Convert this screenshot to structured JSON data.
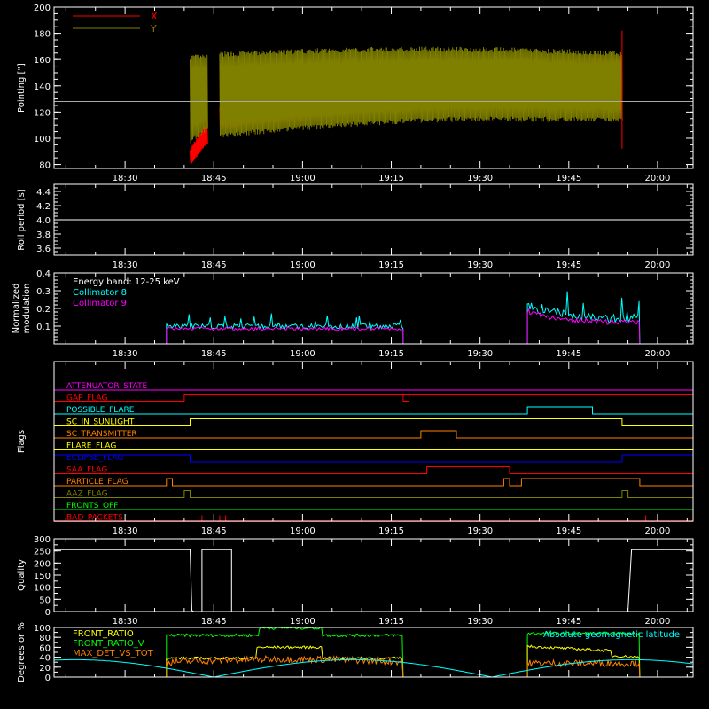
{
  "chart_data": [
    {
      "type": "line",
      "ylabel": "Pointing [\"]",
      "yticks": [
        80,
        100,
        120,
        140,
        160,
        180,
        200
      ],
      "ylim": [
        77,
        200
      ],
      "xticks": [
        "18:30",
        "18:45",
        "19:00",
        "19:15",
        "19:30",
        "19:45",
        "20:00"
      ],
      "series": [
        {
          "name": "X",
          "color": "#ff0000"
        },
        {
          "name": "Y",
          "color": "#808000"
        }
      ],
      "reference_line": 128
    },
    {
      "type": "line",
      "ylabel": "Roll period [s]",
      "yticks": [
        "3.6",
        "3.8",
        "4.0",
        "4.2",
        "4.4"
      ],
      "ylim": [
        3.5,
        4.5
      ],
      "constant_value": 4.0,
      "xticks": [
        "18:30",
        "18:45",
        "19:00",
        "19:15",
        "19:30",
        "19:45",
        "20:00"
      ]
    },
    {
      "type": "line",
      "ylabel": "Normalized modulation",
      "ylabel_lines": [
        "Normalized",
        "modulation"
      ],
      "yticks": [
        "0.1",
        "0.2",
        "0.3",
        "0.4"
      ],
      "ylim": [
        0,
        0.4
      ],
      "annotation": "Energy band: 12-25 keV",
      "series": [
        {
          "name": "Collimator 8",
          "color": "#00ffff"
        },
        {
          "name": "Collimator 9",
          "color": "#ff00ff"
        }
      ],
      "xticks": [
        "18:30",
        "18:45",
        "19:00",
        "19:15",
        "19:30",
        "19:45",
        "20:00"
      ]
    },
    {
      "type": "line",
      "ylabel": "Flags",
      "flags": [
        {
          "name": "ATTENUATOR_STATE",
          "color": "#ff00ff"
        },
        {
          "name": "GAP_FLAG",
          "color": "#ff0000"
        },
        {
          "name": "POSSIBLE_FLARE",
          "color": "#00ffff"
        },
        {
          "name": "SC_IN_SUNLIGHT",
          "color": "#ffff00"
        },
        {
          "name": "SC_TRANSMITTER",
          "color": "#ff8000"
        },
        {
          "name": "FLARE_FLAG",
          "color": "#ffff00"
        },
        {
          "name": "ECLIPSE_FLAG",
          "color": "#0000ff"
        },
        {
          "name": "SAA_FLAG",
          "color": "#ff0000"
        },
        {
          "name": "PARTICLE_FLAG",
          "color": "#ff8000"
        },
        {
          "name": "AAZ_FLAG",
          "color": "#808000"
        },
        {
          "name": "FRONTS_OFF",
          "color": "#00ff00"
        },
        {
          "name": "BAD_PACKETS",
          "color": "#ff0000"
        }
      ],
      "xticks": [
        "18:30",
        "18:45",
        "19:00",
        "19:15",
        "19:30",
        "19:45",
        "20:00"
      ]
    },
    {
      "type": "line",
      "ylabel": "Quality",
      "yticks": [
        0,
        50,
        100,
        150,
        200,
        250,
        300
      ],
      "ylim": [
        0,
        300
      ],
      "xticks": [
        "18:30",
        "18:45",
        "19:00",
        "19:15",
        "19:30",
        "19:45",
        "20:00"
      ]
    },
    {
      "type": "line",
      "ylabel": "Degrees or %",
      "yticks": [
        0,
        20,
        40,
        60,
        80,
        100
      ],
      "ylim": [
        0,
        100
      ],
      "series": [
        {
          "name": "FRONT_RATIO",
          "color": "#ffff00"
        },
        {
          "name": "FRONT_RATIO_V",
          "color": "#00ff00"
        },
        {
          "name": "MAX_DET_VS_TOT",
          "color": "#ff8000"
        },
        {
          "name": "Absolute geomagnetic latitude",
          "color": "#00ffff"
        }
      ]
    }
  ]
}
